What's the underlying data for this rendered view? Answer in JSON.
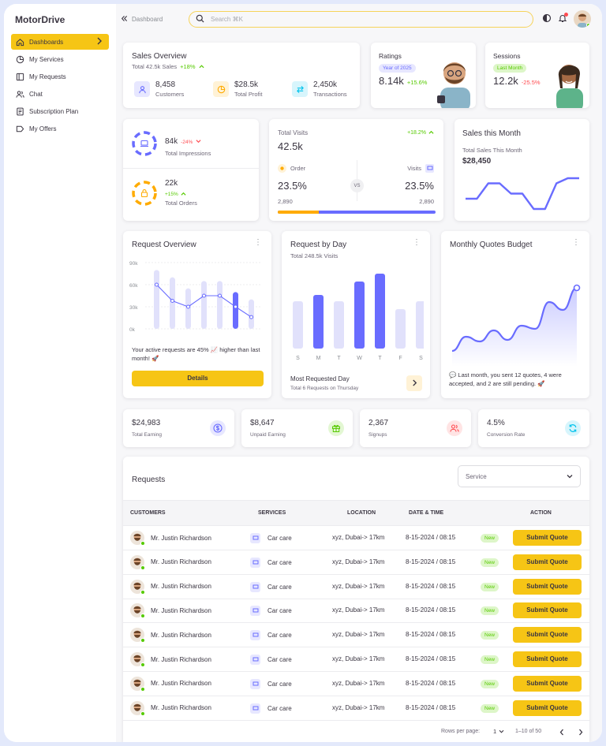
{
  "brand": "MotorDrive",
  "sidebar": {
    "items": [
      {
        "label": "Dashboards",
        "icon": "home-icon",
        "active": true
      },
      {
        "label": "My Services",
        "icon": "pie-icon"
      },
      {
        "label": "My Requests",
        "icon": "layout-icon"
      },
      {
        "label": "Chat",
        "icon": "users-icon"
      },
      {
        "label": "Subscription Plan",
        "icon": "document-icon"
      },
      {
        "label": "My Offers",
        "icon": "tag-icon"
      }
    ]
  },
  "topbar": {
    "breadcrumb": "Dashboard",
    "search_placeholder": "Search ⌘K"
  },
  "sales_overview": {
    "title": "Sales Overview",
    "subtitle": "Total 42.5k Sales",
    "growth": "+18%",
    "stats": [
      {
        "value": "8,458",
        "label": "Customers",
        "color": "#696cff",
        "bg": "#e7e7ff",
        "icon": "user-icon"
      },
      {
        "value": "$28.5k",
        "label": "Total Profit",
        "color": "#ffab00",
        "bg": "#fff2d6",
        "icon": "pie-icon"
      },
      {
        "value": "2,450k",
        "label": "Transactions",
        "color": "#03c3ec",
        "bg": "#d7f5fc",
        "icon": "swap-icon"
      }
    ]
  },
  "ratings": {
    "title": "Ratings",
    "chip": "Year of 2025",
    "value": "8.14k",
    "change": "+15.6%"
  },
  "sessions": {
    "title": "Sessions",
    "chip": "Last Month",
    "value": "12.2k",
    "change": "-25.5%"
  },
  "impressions": {
    "value": "84k",
    "change": "-24%",
    "label": "Total Impressions",
    "progress_pct": 70
  },
  "orders": {
    "value": "22k",
    "change": "+15%",
    "label": "Total Orders",
    "progress_pct": 70
  },
  "visits": {
    "title": "Total Visits",
    "growth": "+18.2%",
    "value": "42.5k",
    "left_label": "Order",
    "right_label": "Visits",
    "vs": "VS",
    "left_pct": "23.5%",
    "right_pct": "23.5%",
    "left_count": "2,890",
    "right_count": "2,890",
    "order_share_pct": 26
  },
  "sales_month": {
    "title": "Sales this Month",
    "subtitle": "Total Sales This Month",
    "value": "$28,450"
  },
  "request_overview": {
    "title": "Request Overview",
    "text": "Your active requests are 45% 📈 higher than last month! 🚀",
    "button": "Details"
  },
  "request_day": {
    "title": "Request by Day",
    "subtitle": "Total 248.5k Visits",
    "footer_title": "Most Requested Day",
    "footer_sub": "Total 6 Requests on Thursday"
  },
  "quotes": {
    "title": "Monthly Quotes Budget",
    "text": "💬 Last month, you sent 12 quotes, 4 were accepted, and 2 are still pending. 🚀"
  },
  "metrics": [
    {
      "value": "$24,983",
      "label": "Total Earning",
      "color": "#696cff",
      "bg": "#e7e7ff",
      "icon": "dollar-icon"
    },
    {
      "value": "$8,647",
      "label": "Unpaid Earning",
      "color": "#56ca00",
      "bg": "#e3f7d3",
      "icon": "gift-icon"
    },
    {
      "value": "2,367",
      "label": "Signups",
      "color": "#ff4c51",
      "bg": "#ffe4e4",
      "icon": "users-icon"
    },
    {
      "value": "4.5%",
      "label": "Conversion Rate",
      "color": "#03c3ec",
      "bg": "#d7f5fc",
      "icon": "refresh-icon"
    }
  ],
  "requests": {
    "title": "Requests",
    "filter": "Service",
    "headers": [
      "CUSTOMERS",
      "SERVICES",
      "LOCATION",
      "DATE & TIME",
      "ACTION"
    ],
    "rows": [
      {
        "name": "Mr. Justin Richardson",
        "service": "Car care",
        "location": "xyz, Dubai-> 17km",
        "datetime": "8-15-2024 / 08:15",
        "status": "New",
        "action": "Submit Quote"
      },
      {
        "name": "Mr. Justin Richardson",
        "service": "Car care",
        "location": "xyz, Dubai-> 17km",
        "datetime": "8-15-2024 / 08:15",
        "status": "New",
        "action": "Submit Quote"
      },
      {
        "name": "Mr. Justin Richardson",
        "service": "Car care",
        "location": "xyz, Dubai-> 17km",
        "datetime": "8-15-2024 / 08:15",
        "status": "New",
        "action": "Submit Quote"
      },
      {
        "name": "Mr. Justin Richardson",
        "service": "Car care",
        "location": "xyz, Dubai-> 17km",
        "datetime": "8-15-2024 / 08:15",
        "status": "New",
        "action": "Submit Quote"
      },
      {
        "name": "Mr. Justin Richardson",
        "service": "Car care",
        "location": "xyz, Dubai-> 17km",
        "datetime": "8-15-2024 / 08:15",
        "status": "New",
        "action": "Submit Quote"
      },
      {
        "name": "Mr. Justin Richardson",
        "service": "Car care",
        "location": "xyz, Dubai-> 17km",
        "datetime": "8-15-2024 / 08:15",
        "status": "New",
        "action": "Submit Quote"
      },
      {
        "name": "Mr. Justin Richardson",
        "service": "Car care",
        "location": "xyz, Dubai-> 17km",
        "datetime": "8-15-2024 / 08:15",
        "status": "New",
        "action": "Submit Quote"
      },
      {
        "name": "Mr. Justin Richardson",
        "service": "Car care",
        "location": "xyz, Dubai-> 17km",
        "datetime": "8-15-2024 / 08:15",
        "status": "New",
        "action": "Submit Quote"
      }
    ],
    "rows_per_page_label": "Rows per page:",
    "rows_per_page": "1",
    "range": "1–10 of 50"
  },
  "chart_data": [
    {
      "type": "bar",
      "title": "Request Overview",
      "ylim": [
        0,
        90000
      ],
      "yticks": [
        "0k",
        "30k",
        "60k",
        "90k"
      ],
      "series": [
        {
          "values": [
            80000,
            70000,
            55000,
            65000,
            65000,
            50000,
            40000
          ]
        },
        {
          "values": [
            60000,
            38000,
            30000,
            45000,
            45000,
            30000,
            16000
          ]
        }
      ],
      "highlight_index": 5
    },
    {
      "type": "bar",
      "title": "Request by Day",
      "categories": [
        "S",
        "M",
        "T",
        "W",
        "T",
        "F",
        "S"
      ],
      "values": [
        60,
        68,
        60,
        85,
        95,
        50,
        60
      ],
      "highlight": [
        1,
        3,
        4
      ]
    },
    {
      "type": "line",
      "title": "Sales this Month",
      "values": [
        2,
        2,
        5,
        5,
        3,
        3,
        0,
        0,
        5,
        6,
        6
      ]
    },
    {
      "type": "area",
      "title": "Monthly Quotes Budget",
      "values": [
        10,
        28,
        22,
        36,
        24,
        42,
        38,
        72,
        62,
        90
      ]
    }
  ]
}
